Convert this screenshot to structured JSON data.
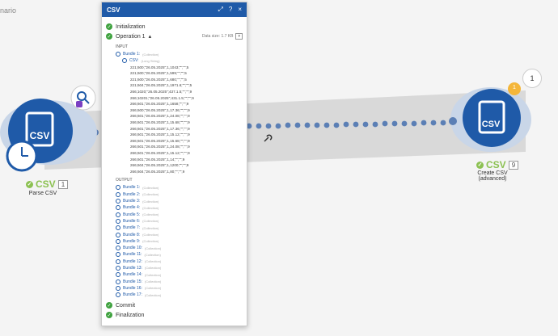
{
  "breadcrumb": "nario",
  "left_module": {
    "app": "CSV",
    "count": "1",
    "label": "Parse CSV"
  },
  "right_module": {
    "app": "CSV",
    "count": "9",
    "label": "Create CSV (advanced)",
    "badge": "1",
    "bubble": "1"
  },
  "panel": {
    "title": "CSV",
    "controls": {
      "expand": "⤢",
      "help": "?",
      "close": "×"
    },
    "initialization": "Initialization",
    "operation": "Operation 1",
    "data_size": "Data size: 1.7 KB",
    "input_label": "INPUT",
    "input_bundle": "Bundle 1:",
    "input_bundle_type": "(Collection)",
    "csv_field": "CSV:",
    "csv_type": "(Long String)",
    "csv_lines": [
      "221;600;\"26.05.2025\";1,1043;\"\";\"\";5",
      "221;600;\"26.05.2025\";1,599;\"\";\"\";5",
      "221;600;\"26.05.2025\";1,680;\"\";\"\";5",
      "221;604;\"26.05.2025\";1,1971.6;\"\";\"\";5",
      "266;1020;\"26.05.2025\";437.1.5;\"\";\"\";9",
      "266;10201;\"26.05.2025\";431.1.5;\"\";\"\";9",
      "266;601;\"26.05.2025\";1,1658;\"\";\"\";9",
      "266;600;\"26.05.2025\";1,17.36;\"\";\"\";9",
      "266;601;\"26.05.2025\";1,24.08;\"\";\"\";9",
      "266;601;\"26.05.2025\";1,15.68;\"\";\"\";9",
      "266;601;\"26.05.2025\";1,17.36;\"\";\"\";9",
      "266;601;\"26.05.2025\";1,15.12;\"\";\"\";9",
      "266;601;\"26.05.2025\";1,15.68;\"\";\"\";9",
      "266;601;\"26.05.2025\";1,24.08;\"\";\"\";9",
      "266;601;\"26.05.2025\";1,15.12;\"\";\"\";9",
      "266;601;\"26.05.2025\";1,14;\"\";\"\";9",
      "266;604;\"26.05.2025\";1,1200;\"\";\"\";9",
      "266;604;\"26.05.2025\";1,80;\"\";\"\";9"
    ],
    "output_label": "OUTPUT",
    "output_bundles": [
      "Bundle 1:",
      "Bundle 2:",
      "Bundle 3:",
      "Bundle 4:",
      "Bundle 5:",
      "Bundle 6:",
      "Bundle 7:",
      "Bundle 8:",
      "Bundle 9:",
      "Bundle 10:",
      "Bundle 11:",
      "Bundle 12:",
      "Bundle 13:",
      "Bundle 14:",
      "Bundle 15:",
      "Bundle 16:",
      "Bundle 17:"
    ],
    "collection_text": "(Collection)",
    "commit": "Commit",
    "finalization": "Finalization"
  },
  "colors": {
    "accent": "#1f5aa8",
    "success": "#3fa23f",
    "csv_green": "#8cc152"
  },
  "icons": {
    "wrench": "wrench-icon",
    "search": "search-icon",
    "clock": "clock-icon"
  }
}
